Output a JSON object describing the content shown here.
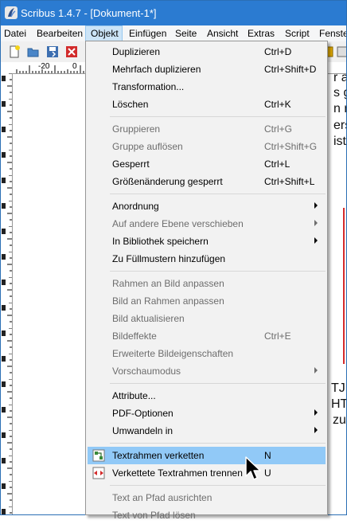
{
  "window": {
    "title": "Scribus 1.4.7 - [Dokument-1*]"
  },
  "menubar": {
    "items": [
      "Datei",
      "Bearbeiten",
      "Objekt",
      "Einfügen",
      "Seite",
      "Ansicht",
      "Extras",
      "Script",
      "Fenster"
    ],
    "active": "Objekt"
  },
  "ruler": {
    "labels": [
      "-20",
      "0"
    ]
  },
  "background_text": [
    "r a",
    "s gr",
    "n na",
    "erso",
    "ist",
    "TJ",
    "HT",
    "zu"
  ],
  "menu": {
    "items": [
      {
        "label": "Duplizieren",
        "shortcut": "Ctrl+D",
        "enabled": true
      },
      {
        "label": "Mehrfach duplizieren",
        "shortcut": "Ctrl+Shift+D",
        "enabled": true
      },
      {
        "label": "Transformation...",
        "shortcut": "",
        "enabled": true
      },
      {
        "label": "Löschen",
        "shortcut": "Ctrl+K",
        "enabled": true
      },
      {
        "label": "Gruppieren",
        "shortcut": "Ctrl+G",
        "enabled": false
      },
      {
        "label": "Gruppe auflösen",
        "shortcut": "Ctrl+Shift+G",
        "enabled": false
      },
      {
        "label": "Gesperrt",
        "shortcut": "Ctrl+L",
        "enabled": true
      },
      {
        "label": "Größenänderung gesperrt",
        "shortcut": "Ctrl+Shift+L",
        "enabled": true
      },
      {
        "label": "Anordnung",
        "shortcut": "",
        "enabled": true,
        "submenu": true
      },
      {
        "label": "Auf andere Ebene verschieben",
        "shortcut": "",
        "enabled": false,
        "submenu": true
      },
      {
        "label": "In Bibliothek speichern",
        "shortcut": "",
        "enabled": true,
        "submenu": true
      },
      {
        "label": "Zu Füllmustern hinzufügen",
        "shortcut": "",
        "enabled": true
      },
      {
        "label": "Rahmen an Bild anpassen",
        "shortcut": "",
        "enabled": false
      },
      {
        "label": "Bild an Rahmen anpassen",
        "shortcut": "",
        "enabled": false
      },
      {
        "label": "Bild aktualisieren",
        "shortcut": "",
        "enabled": false
      },
      {
        "label": "Bildeffekte",
        "shortcut": "Ctrl+E",
        "enabled": false
      },
      {
        "label": "Erweiterte Bildeigenschaften",
        "shortcut": "",
        "enabled": false
      },
      {
        "label": "Vorschaumodus",
        "shortcut": "",
        "enabled": false,
        "submenu": true
      },
      {
        "label": "Attribute...",
        "shortcut": "",
        "enabled": true
      },
      {
        "label": "PDF-Optionen",
        "shortcut": "",
        "enabled": true,
        "submenu": true
      },
      {
        "label": "Umwandeln in",
        "shortcut": "",
        "enabled": true,
        "submenu": true
      },
      {
        "label": "Textrahmen verketten",
        "shortcut": "N",
        "enabled": true,
        "highlighted": true,
        "icon": "link-frames-icon"
      },
      {
        "label": "Verkettete Textrahmen trennen",
        "shortcut": "U",
        "enabled": true,
        "icon": "unlink-frames-icon"
      },
      {
        "label": "Text an Pfad ausrichten",
        "shortcut": "",
        "enabled": false
      },
      {
        "label": "Text von Pfad lösen",
        "shortcut": "",
        "enabled": false
      }
    ]
  },
  "colors": {
    "titlebar": "#2b7bd1",
    "highlight": "#91c9f7",
    "menu_bg": "#f2f2f2",
    "disabled_text": "#6d6d6d"
  }
}
